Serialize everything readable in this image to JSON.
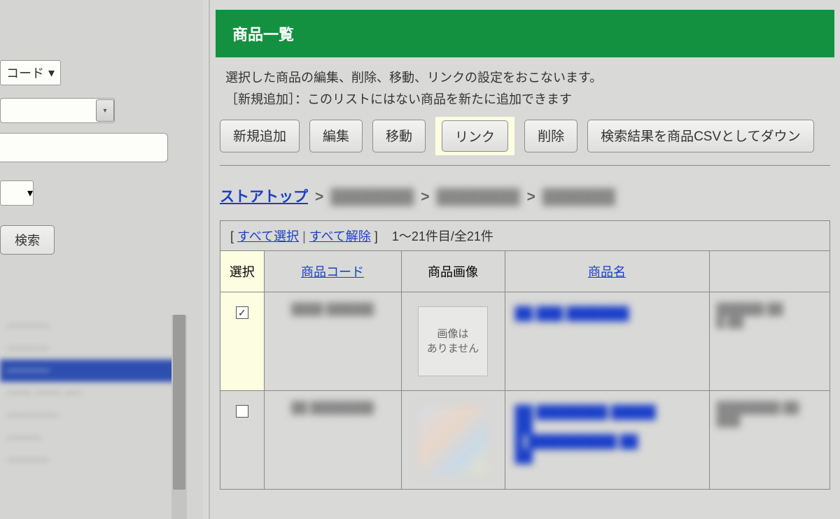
{
  "sidebar": {
    "select1_label": "コード",
    "search_btn": "検索",
    "list_items": [
      "─────",
      "─────",
      "─────",
      "─── ─── ──",
      "──────",
      "────",
      "─────"
    ]
  },
  "header": {
    "title": "商品一覧"
  },
  "description": {
    "line1": "選択した商品の編集、削除、移動、リンクの設定をおこないます。",
    "line2": "［新規追加］：このリストにはない商品を新たに追加できます"
  },
  "toolbar": {
    "new": "新規追加",
    "edit": "編集",
    "move": "移動",
    "link": "リンク",
    "delete": "削除",
    "csv": "検索結果を商品CSVとしてダウン"
  },
  "breadcrumb": {
    "root": "ストアトップ",
    "sep": ">"
  },
  "table_top": {
    "open_bracket": "[ ",
    "select_all": "すべて選択",
    "pipe": " | ",
    "deselect_all": "すべて解除",
    "close_bracket": " ]",
    "count": "1～21件目/全21件"
  },
  "columns": {
    "select": "選択",
    "code": "商品コード",
    "image": "商品画像",
    "name": "商品名"
  },
  "noimage_text": "画像は\nありません",
  "checkmark": "✓"
}
